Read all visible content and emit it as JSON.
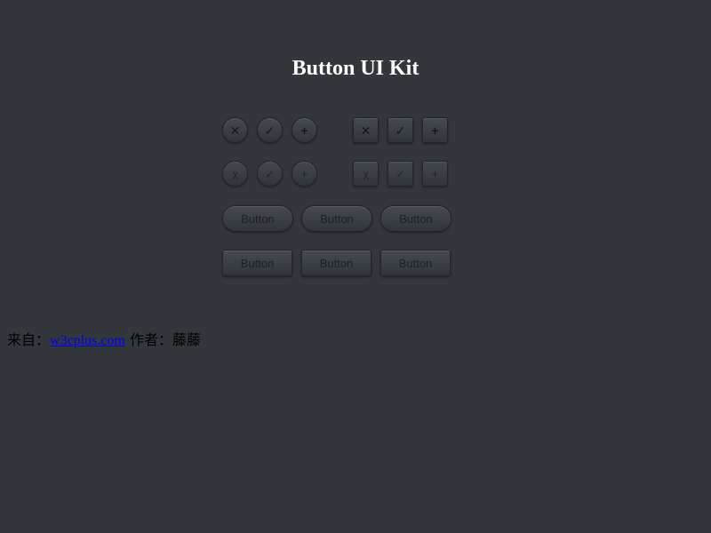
{
  "page": {
    "title": "Button UI Kit"
  },
  "icon_buttons": {
    "row1": [
      {
        "shape": "circle",
        "icon": "close-icon",
        "glyph": "✕"
      },
      {
        "shape": "circle",
        "icon": "check-icon",
        "glyph": "✓"
      },
      {
        "shape": "circle",
        "icon": "plus-icon",
        "glyph": "+"
      },
      {
        "shape": "square",
        "icon": "close-icon",
        "glyph": "✕"
      },
      {
        "shape": "square",
        "icon": "check-icon",
        "glyph": "✓"
      },
      {
        "shape": "square",
        "icon": "plus-icon",
        "glyph": "+"
      }
    ],
    "row2": [
      {
        "shape": "circle",
        "icon": "close-icon",
        "glyph": "χ"
      },
      {
        "shape": "circle",
        "icon": "check-icon",
        "glyph": "✓"
      },
      {
        "shape": "circle",
        "icon": "plus-icon",
        "glyph": "+"
      },
      {
        "shape": "square",
        "icon": "close-icon",
        "glyph": "χ"
      },
      {
        "shape": "square",
        "icon": "check-icon",
        "glyph": "✓"
      },
      {
        "shape": "square",
        "icon": "plus-icon",
        "glyph": "+"
      }
    ]
  },
  "text_buttons": {
    "pill_labels": [
      "Button",
      "Button",
      "Button"
    ],
    "rect_labels": [
      "Button",
      "Button",
      "Button"
    ]
  },
  "footer": {
    "source_label": "来自：",
    "link_text": "w3cplus.com",
    "author_label": " 作者：",
    "author_name": "藤藤"
  },
  "colors": {
    "background": "#33373c",
    "title": "#ffffff",
    "link": "#0000ee"
  }
}
